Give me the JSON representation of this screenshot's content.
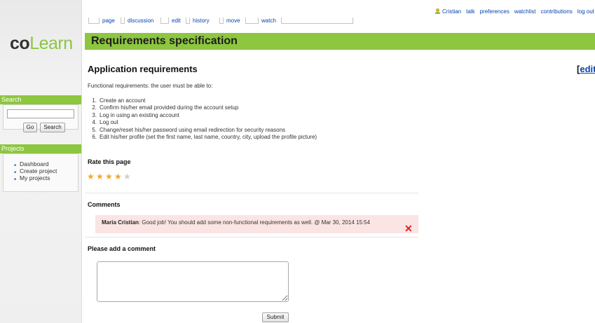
{
  "logo": {
    "part1": "co",
    "part2": "Learn"
  },
  "sidebar": {
    "search": {
      "heading": "Search",
      "input_value": "",
      "go_label": "Go",
      "search_label": "Search"
    },
    "projects": {
      "heading": "Projects",
      "items": [
        "Dashboard",
        "Create project",
        "My projects"
      ]
    }
  },
  "tabs": [
    "page",
    "discussion",
    "edit",
    "history",
    "move",
    "watch"
  ],
  "user_tools": {
    "username": "Cristian",
    "items": [
      "talk",
      "preferences",
      "watchlist",
      "contributions",
      "log out"
    ]
  },
  "page_title": "Requirements specification",
  "content": {
    "section_heading": "Application requirements",
    "edit_link": "edit",
    "intro": "Functional requirements: the user must be able to:",
    "requirements": [
      {
        "num": "1.",
        "text": "Create an account"
      },
      {
        "num": "2.",
        "text": "Confirm his/her email provided during the account setup"
      },
      {
        "num": "3.",
        "text": "Log in using an existing account"
      },
      {
        "num": "4.",
        "text": "Log out"
      },
      {
        "num": "5.",
        "text": "Change/reset his/her password using email redirection for security reasons"
      },
      {
        "num": "6.",
        "text": "Edit his/her profile (set the first name, last name, country, city, upload the profile picture)"
      }
    ],
    "rating": {
      "heading": "Rate this page",
      "value": 4,
      "max": 5,
      "filled_color": "#f0a830",
      "empty_color": "#cfcfcf"
    },
    "comments": {
      "heading": "Comments",
      "items": [
        {
          "author": "Maria Cristian",
          "text": ": Good job! You should add some non-functional requirements as well. @ Mar 30, 2014 15:54"
        }
      ]
    },
    "add_comment": {
      "heading": "Please add a comment",
      "value": "",
      "submit_label": "Submit"
    }
  },
  "colors": {
    "accent": "#8dc63f",
    "link": "#0645ad",
    "comment_bg": "#fbe4e4",
    "delete": "#dd2222"
  }
}
